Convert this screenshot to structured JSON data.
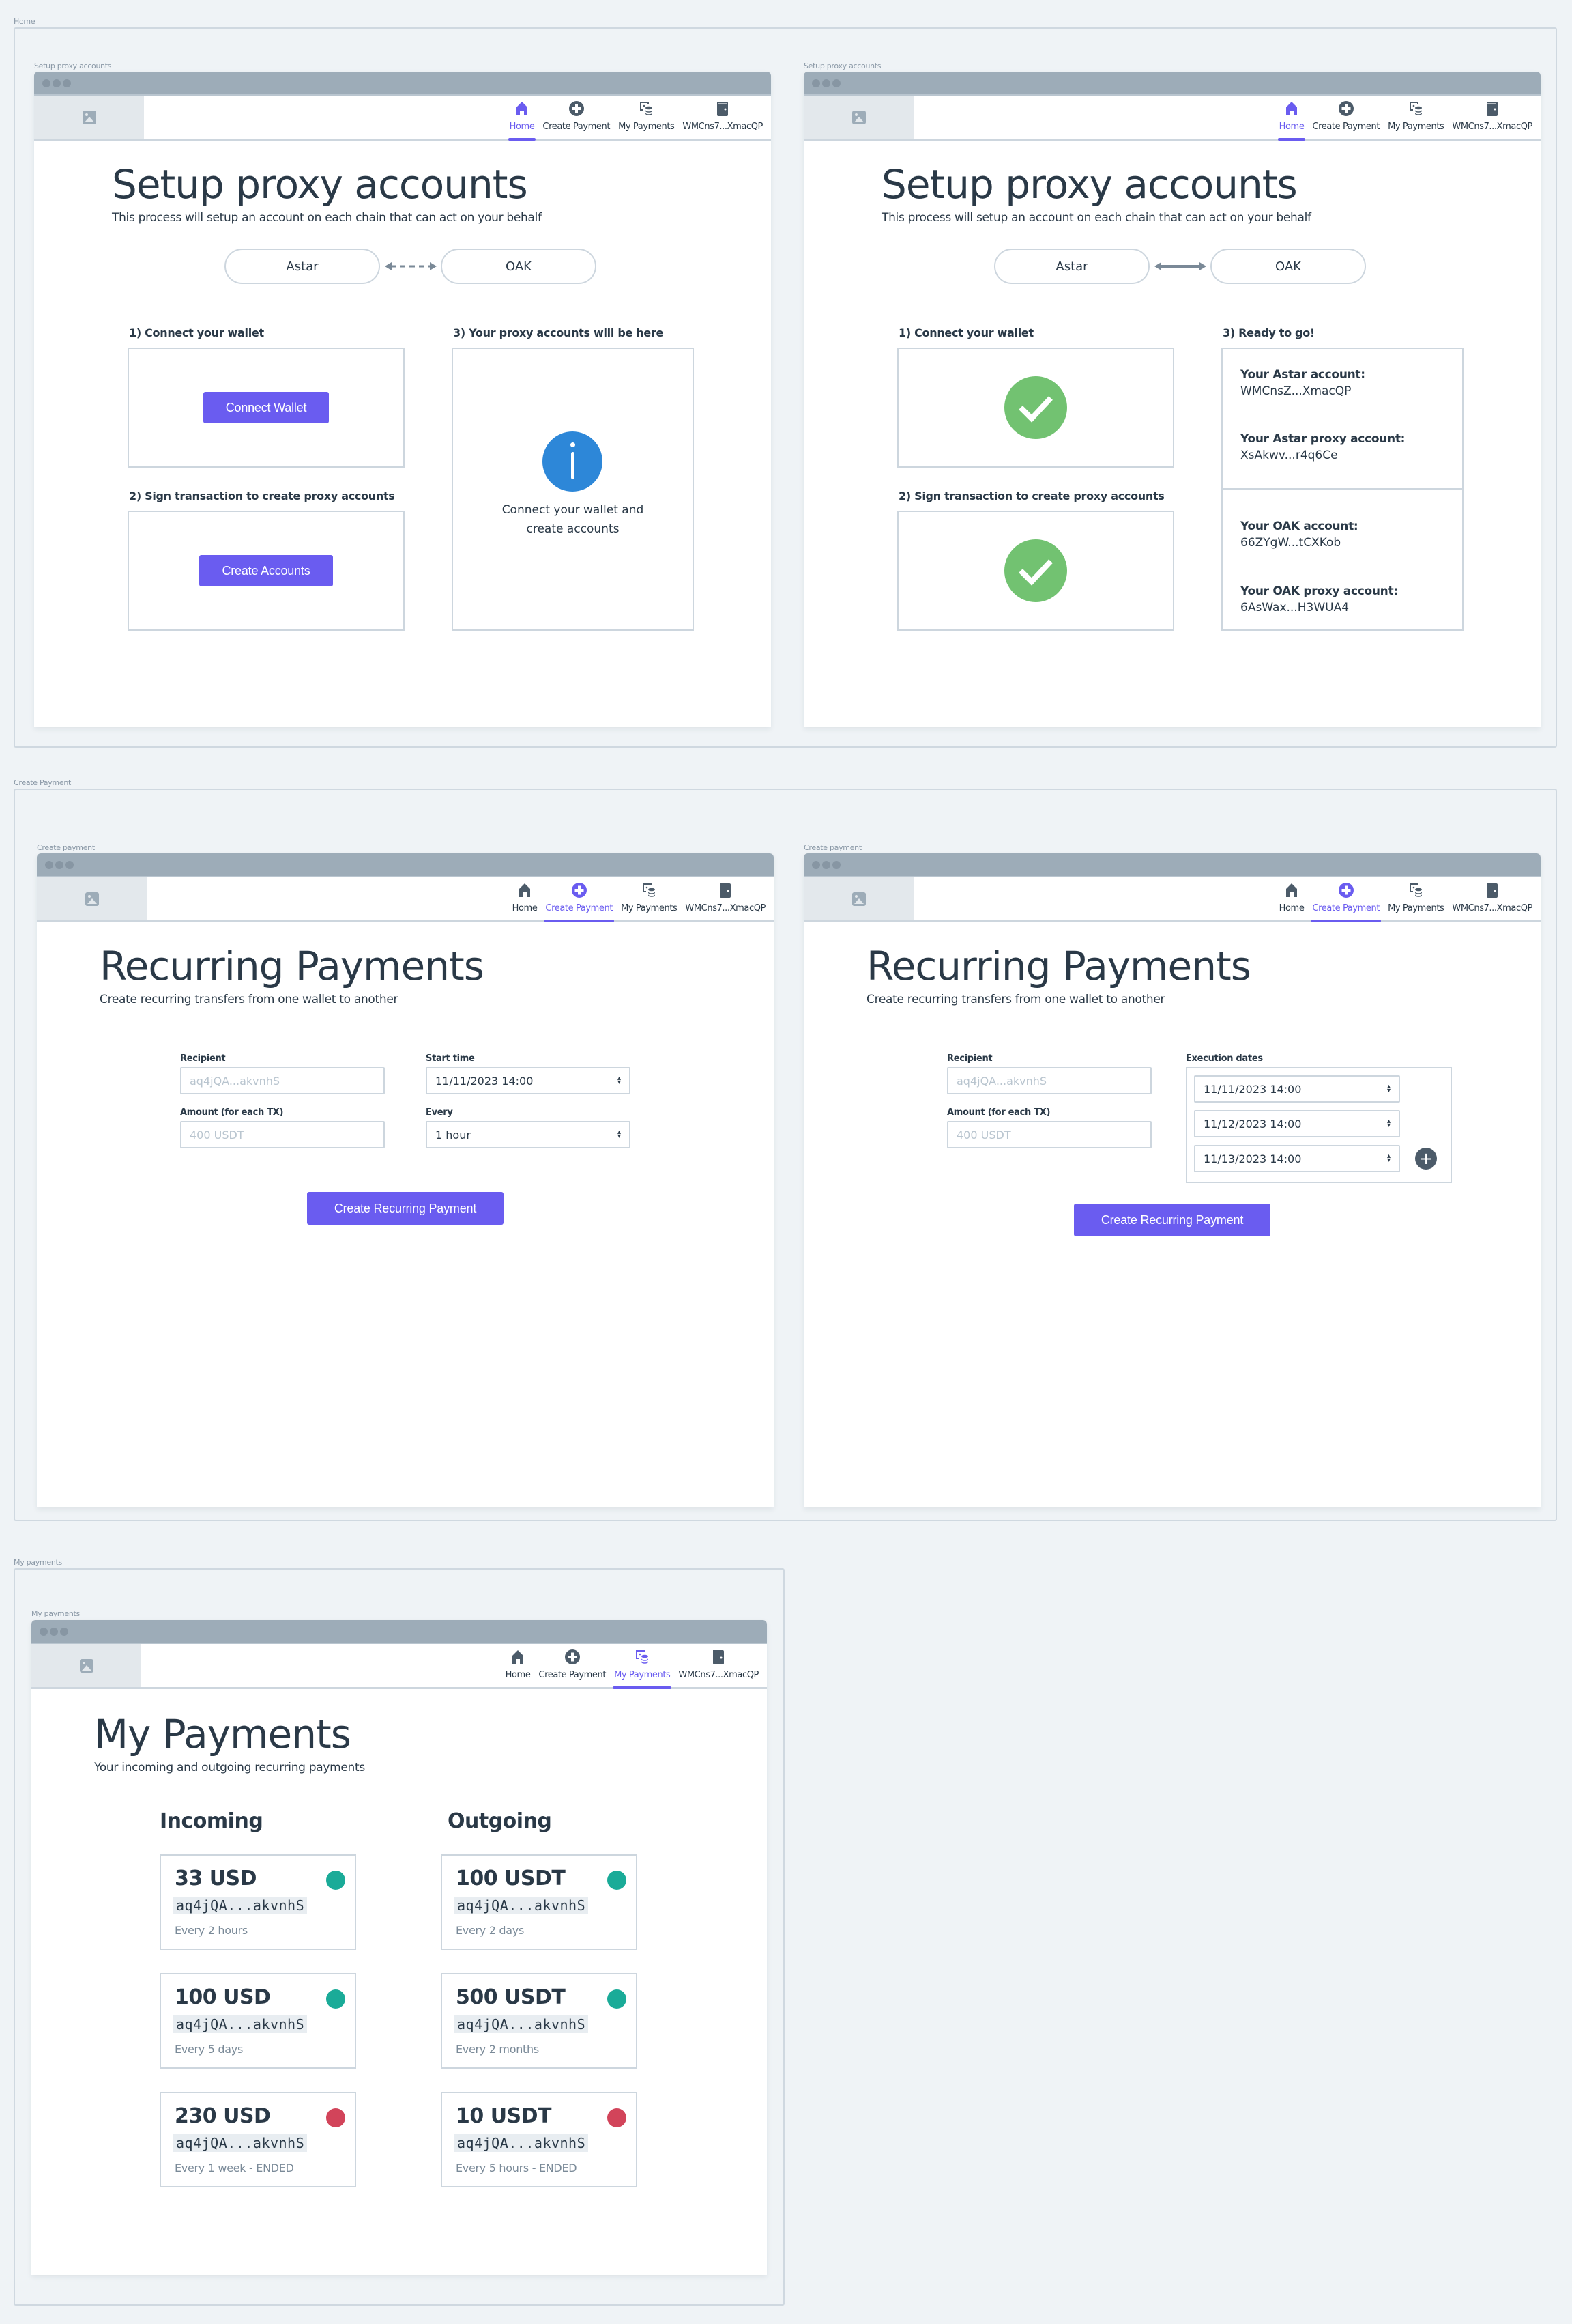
{
  "colors": {
    "accent": "#6a5cf0",
    "text": "#2a3947",
    "info_blue": "#2d87d8",
    "success_green": "#72c271",
    "status_active": "#1aab98",
    "status_ended": "#d2445a",
    "titlebar": "#9dacb8"
  },
  "nav": {
    "home": "Home",
    "create_payment": "Create Payment",
    "my_payments": "My Payments",
    "wallet": "WMCns7...XmacQP"
  },
  "frames": {
    "home": {
      "label": "Home",
      "screens": [
        {
          "label": "Setup proxy accounts",
          "title": "Setup proxy accounts",
          "subtitle": "This process will setup an account on each chain that can act on your behalf",
          "chain_a": "Astar",
          "chain_b": "OAK",
          "link_state": "pending",
          "step1_title": "1) Connect your wallet",
          "step1_button": "Connect Wallet",
          "step2_title": "2) Sign transaction to create proxy accounts",
          "step2_button": "Create Accounts",
          "step3_title": "3) Your proxy accounts will be here",
          "step3_info_line1": "Connect your wallet and",
          "step3_info_line2": "create accounts"
        },
        {
          "label": "Setup proxy accounts",
          "title": "Setup proxy accounts",
          "subtitle": "This process will setup an account on each chain that can act on your behalf",
          "chain_a": "Astar",
          "chain_b": "OAK",
          "link_state": "linked",
          "step1_title": "1) Connect your wallet",
          "step2_title": "2) Sign transaction to create proxy accounts",
          "step3_title": "3) Ready to go!",
          "accounts": [
            {
              "label": "Your Astar account:",
              "value": "WMCnsZ...XmacQP"
            },
            {
              "label": "Your Astar proxy account:",
              "value": "XsAkwv...r4q6Ce"
            },
            {
              "label": "Your OAK account:",
              "value": "66ZYgW...tCXKob"
            },
            {
              "label": "Your OAK proxy account:",
              "value": "6AsWax...H3WUA4"
            }
          ]
        }
      ]
    },
    "create_payment": {
      "label": "Create Payment",
      "screens": [
        {
          "label": "Create payment",
          "title": "Recurring Payments",
          "subtitle": "Create recurring transfers from one wallet to another",
          "recipient_label": "Recipient",
          "recipient_placeholder": "aq4jQA...akvnhS",
          "amount_label": "Amount (for each TX)",
          "amount_placeholder": "400 USDT",
          "start_label": "Start time",
          "start_value": "11/11/2023 14:00",
          "every_label": "Every",
          "every_value": "1 hour",
          "submit": "Create Recurring Payment"
        },
        {
          "label": "Create payment",
          "title": "Recurring Payments",
          "subtitle": "Create recurring transfers from one wallet to another",
          "recipient_label": "Recipient",
          "recipient_placeholder": "aq4jQA...akvnhS",
          "amount_label": "Amount (for each TX)",
          "amount_placeholder": "400 USDT",
          "dates_label": "Execution dates",
          "dates": [
            "11/11/2023 14:00",
            "11/12/2023 14:00",
            "11/13/2023 14:00"
          ],
          "submit": "Create Recurring Payment"
        }
      ]
    },
    "my_payments": {
      "label": "My payments",
      "screen_label": "My payments",
      "title": "My Payments",
      "subtitle": "Your incoming and outgoing recurring payments",
      "incoming_title": "Incoming",
      "outgoing_title": "Outgoing",
      "incoming": [
        {
          "amount": "33 USD",
          "address": "aq4jQA...akvnhS",
          "frequency": "Every 2 hours",
          "status": "active"
        },
        {
          "amount": "100 USD",
          "address": "aq4jQA...akvnhS",
          "frequency": "Every 5 days",
          "status": "active"
        },
        {
          "amount": "230 USD",
          "address": "aq4jQA...akvnhS",
          "frequency": "Every 1 week - ENDED",
          "status": "ended"
        }
      ],
      "outgoing": [
        {
          "amount": "100 USDT",
          "address": "aq4jQA...akvnhS",
          "frequency": "Every 2 days",
          "status": "active"
        },
        {
          "amount": "500 USDT",
          "address": "aq4jQA...akvnhS",
          "frequency": "Every 2 months",
          "status": "active"
        },
        {
          "amount": "10 USDT",
          "address": "aq4jQA...akvnhS",
          "frequency": "Every 5 hours - ENDED",
          "status": "ended"
        }
      ]
    }
  }
}
